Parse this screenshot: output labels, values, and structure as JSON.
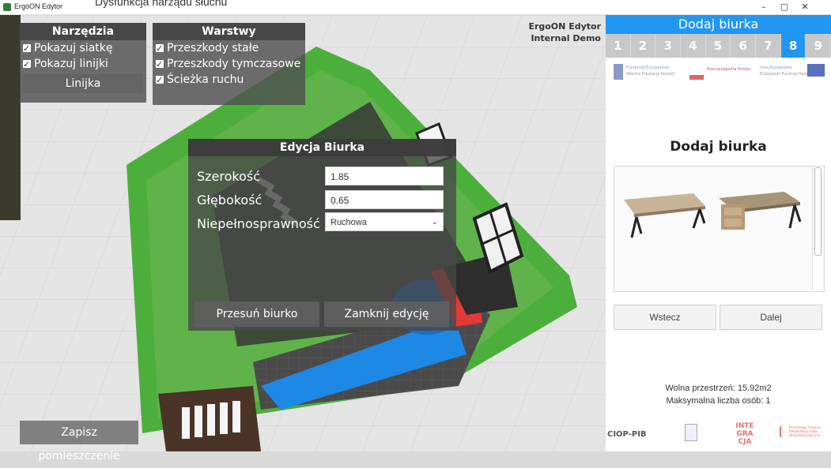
{
  "window": {
    "title": "ErgoON Edytor",
    "behind_text": "Dysfunkcja narządu słuchu",
    "minimize": "–",
    "maximize": "▢",
    "close": "✕"
  },
  "tools_panel": {
    "title": "Narzędzia",
    "show_grid": "Pokazuj siatkę",
    "show_rulers": "Pokazuj linijki",
    "ruler_button": "Linijka"
  },
  "layers_panel": {
    "title": "Warstwy",
    "items": [
      "Przeszkody stałe",
      "Przeszkody tymczasowe",
      "Ścieżka ruchu"
    ]
  },
  "demo_label": {
    "line1": "ErgoON Edytor",
    "line2": "Internal Demo"
  },
  "edit_dialog": {
    "title": "Edycja Biurka",
    "width_label": "Szerokość",
    "width_value": "1.85",
    "depth_label": "Głębokość",
    "depth_value": "0.65",
    "disability_label": "Niepełnosprawność",
    "disability_value": "Ruchowa",
    "move_button": "Przesuń biurko",
    "close_button": "Zamknij edycję"
  },
  "save_button": "Zapisz pomieszczenie",
  "right_panel": {
    "header": "Dodaj biurka",
    "tabs": [
      "1",
      "2",
      "3",
      "4",
      "5",
      "6",
      "7",
      "8",
      "9"
    ],
    "active_tab": "8",
    "title": "Dodaj biurka",
    "back_button": "Wstecz",
    "next_button": "Dalej",
    "free_space": "Wolna przestrzeń: 15.92m2",
    "max_persons": "Maksymalna liczba osób: 1",
    "eu_logos": {
      "funds": "Fundusze Europejskie",
      "funds_sub": "Wiedza Edukacja Rozwój",
      "poland": "Rzeczpospolita Polska",
      "eu": "Unia Europejska",
      "eu_sub": "Europejski Fundusz Społeczny"
    },
    "footer_logos": {
      "ciop": "CIOP-PIB",
      "integracja": "INTE GRA CJA",
      "pfron": "Państwowy Fundusz Rehabilitacji Osób Niepełnosprawnych"
    }
  },
  "colors": {
    "accent": "#2196f3",
    "floor_green": "#5fb34a",
    "wall_green": "#4caf3c",
    "path_blue": "#1e88e5"
  }
}
